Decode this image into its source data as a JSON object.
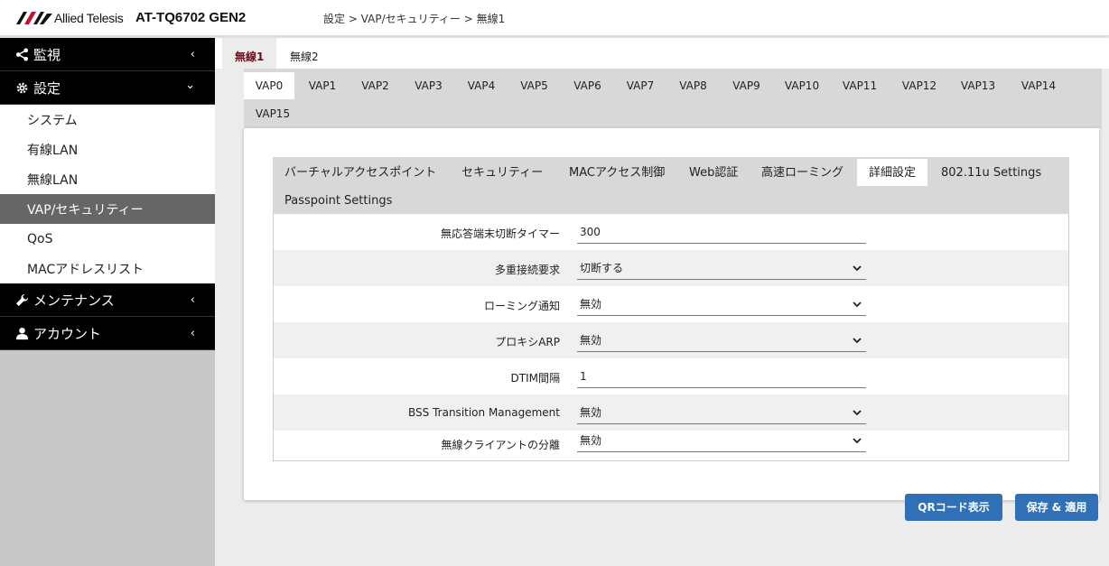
{
  "header": {
    "brand": "Allied Telesis",
    "model": "AT-TQ6702 GEN2",
    "breadcrumb": "設定 > VAP/セキュリティー > 無線1"
  },
  "sidebar": {
    "sections": [
      {
        "label": "監視",
        "icon": "share-icon"
      },
      {
        "label": "設定",
        "icon": "gear-icon"
      },
      {
        "label": "メンテナンス",
        "icon": "wrench-icon"
      },
      {
        "label": "アカウント",
        "icon": "user-icon"
      }
    ],
    "sub_items": [
      {
        "label": "システム"
      },
      {
        "label": "有線LAN"
      },
      {
        "label": "無線LAN"
      },
      {
        "label": "VAP/セキュリティー"
      },
      {
        "label": "QoS"
      },
      {
        "label": "MACアドレスリスト"
      }
    ]
  },
  "radio_tabs": [
    {
      "label": "無線1"
    },
    {
      "label": "無線2"
    }
  ],
  "vap_tabs": [
    {
      "label": "VAP0"
    },
    {
      "label": "VAP1"
    },
    {
      "label": "VAP2"
    },
    {
      "label": "VAP3"
    },
    {
      "label": "VAP4"
    },
    {
      "label": "VAP5"
    },
    {
      "label": "VAP6"
    },
    {
      "label": "VAP7"
    },
    {
      "label": "VAP8"
    },
    {
      "label": "VAP9"
    },
    {
      "label": "VAP10"
    },
    {
      "label": "VAP11"
    },
    {
      "label": "VAP12"
    },
    {
      "label": "VAP13"
    },
    {
      "label": "VAP14"
    },
    {
      "label": "VAP15"
    }
  ],
  "sub_tabs": [
    {
      "label": "バーチャルアクセスポイント"
    },
    {
      "label": "セキュリティー"
    },
    {
      "label": "MACアクセス制御"
    },
    {
      "label": "Web認証"
    },
    {
      "label": "高速ローミング"
    },
    {
      "label": "詳細設定"
    },
    {
      "label": "802.11u Settings"
    },
    {
      "label": "Passpoint Settings"
    }
  ],
  "form": {
    "rows": [
      {
        "label": "無応答端末切断タイマー",
        "value": "300"
      },
      {
        "label": "多重接続要求",
        "value": "切断する"
      },
      {
        "label": "ローミング通知",
        "value": "無効"
      },
      {
        "label": "プロキシARP",
        "value": "無効"
      },
      {
        "label": "DTIM間隔",
        "value": "1"
      },
      {
        "label": "BSS Transition Management",
        "value": "無効"
      },
      {
        "label": "無線クライアントの分離",
        "value": "無効"
      }
    ]
  },
  "buttons": {
    "qr": "QRコード表示",
    "save": "保存 & 適用"
  },
  "colors": {
    "primary_button": "#2f70b6",
    "active_tab_text": "#6b0f1a",
    "sidebar_active": "#666666",
    "logo_red": "#c8102e"
  }
}
